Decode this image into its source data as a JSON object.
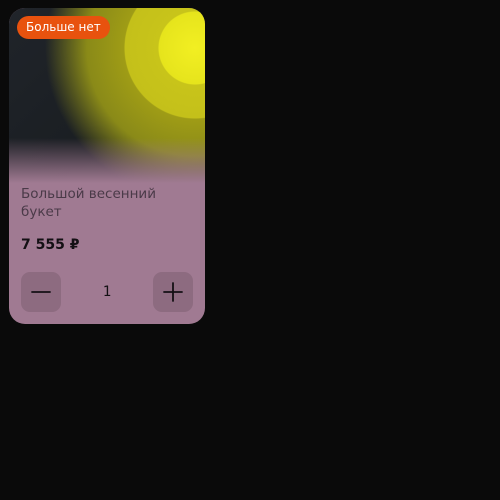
{
  "product": {
    "badge": "Больше нет",
    "title": "Большой весенний букет",
    "price": "7 555 ₽",
    "image_icon": "yellow-flower-image"
  },
  "quantity": {
    "value": "1",
    "decrement_icon": "minus-icon",
    "increment_icon": "plus-icon"
  },
  "colors": {
    "background": "#0a0a0a",
    "card": "#a07a92",
    "badge": "#e8520e",
    "button": "#8d6b80",
    "flower": "#f2ef22"
  }
}
